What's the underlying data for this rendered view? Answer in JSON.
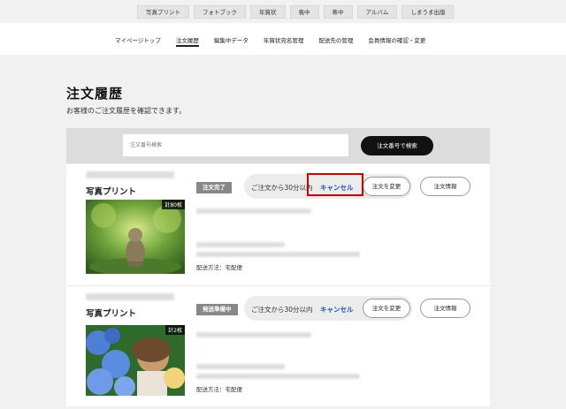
{
  "top_categories": [
    "写真プリント",
    "フォトブック",
    "年賀状",
    "喪中",
    "寒中",
    "アルバム",
    "しまうま出版"
  ],
  "sub_nav": {
    "items": [
      "マイページトップ",
      "注文履歴",
      "編集中データ",
      "年賀状宛名管理",
      "配送先の管理",
      "会員情報の確認・変更"
    ],
    "active_index": 1
  },
  "page": {
    "title": "注文履歴",
    "description": "お客様のご注文履歴を確認できます。"
  },
  "search": {
    "placeholder": "注文番号検索",
    "button_label": "注文番号で検索"
  },
  "orders": [
    {
      "product": "写真プリント",
      "count_badge": "計80枚",
      "status": "注文完了",
      "within_text": "ご注文から30分以内",
      "cancel_label": "キャンセル",
      "change_label": "注文を変更",
      "info_label": "注文情報",
      "delivery": "配送方法：宅配便"
    },
    {
      "product": "写真プリント",
      "count_badge": "計2枚",
      "status": "発送準備中",
      "within_text": "ご注文から30分以内",
      "cancel_label": "キャンセル",
      "change_label": "注文を変更",
      "info_label": "注文情報",
      "delivery": "配送方法：宅配便"
    }
  ],
  "colors": {
    "accent_link": "#1b55b5",
    "highlight_border": "#d40000",
    "button_dark": "#111111",
    "status_badge": "#888888"
  }
}
